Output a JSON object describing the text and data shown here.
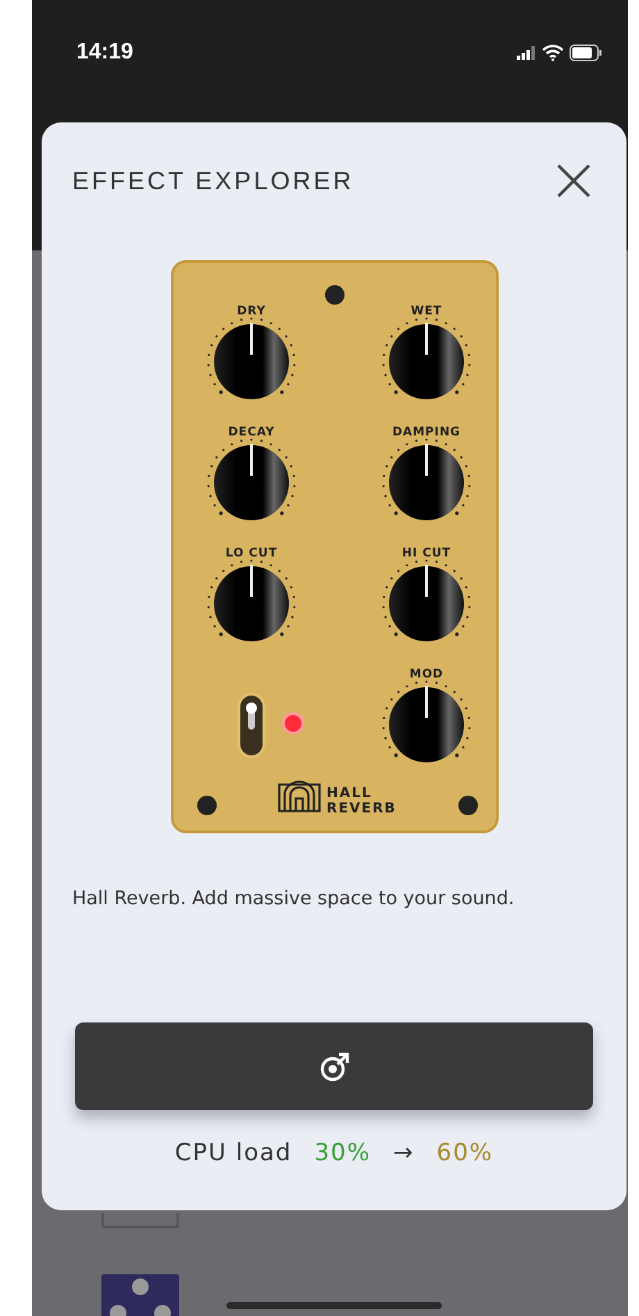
{
  "status_bar": {
    "time": "14:19"
  },
  "dialog": {
    "title": "EFFECT EXPLORER",
    "pedal": {
      "knobs": [
        {
          "label": "DRY"
        },
        {
          "label": "WET"
        },
        {
          "label": "DECAY"
        },
        {
          "label": "DAMPING"
        },
        {
          "label": "LO CUT"
        },
        {
          "label": "HI CUT"
        },
        {
          "label": "MOD"
        }
      ],
      "switch": {
        "on": true
      },
      "led": {
        "on": true
      },
      "logo": {
        "line1": "HALL",
        "line2": "REVERB"
      }
    },
    "description": "Hall Reverb. Add massive space to your sound.",
    "cpu": {
      "label": "CPU load",
      "current": "30%",
      "arrow": "→",
      "projected": "60%"
    }
  }
}
